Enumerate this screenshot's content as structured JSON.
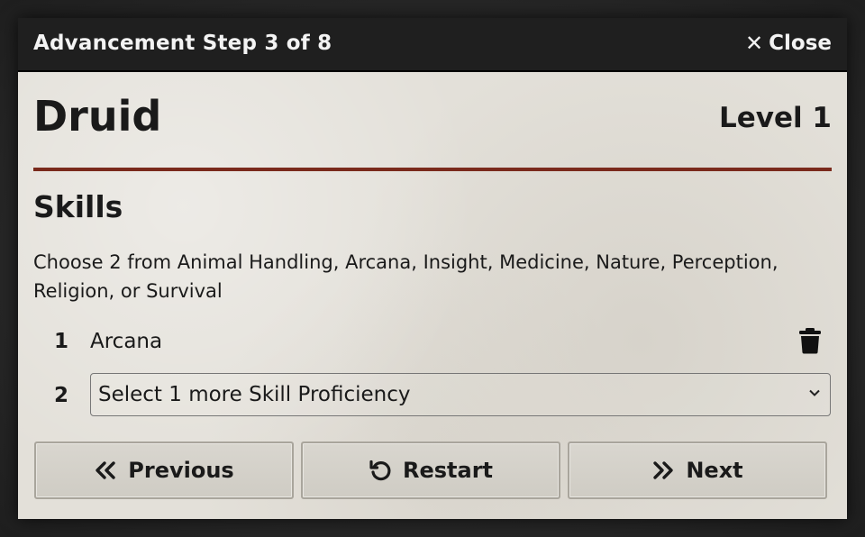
{
  "dialog": {
    "title": "Advancement Step 3 of 8",
    "close_label": "Close",
    "close_icon": "close-icon"
  },
  "header": {
    "class_name": "Druid",
    "level": "Level 1"
  },
  "section": {
    "title": "Skills",
    "description": "Choose 2 from Animal Handling, Arcana, Insight, Medicine, Nature, Perception, Religion, or Survival"
  },
  "choices": [
    {
      "number": "1",
      "value": "Arcana"
    },
    {
      "number": "2",
      "placeholder": "Select 1 more Skill Proficiency"
    }
  ],
  "buttons": {
    "previous": "Previous",
    "restart": "Restart",
    "next": "Next"
  },
  "colors": {
    "titlebar": "#1f1f1f",
    "divider_accent": "#7a2a1c",
    "parchment": "#e3e0d9"
  }
}
